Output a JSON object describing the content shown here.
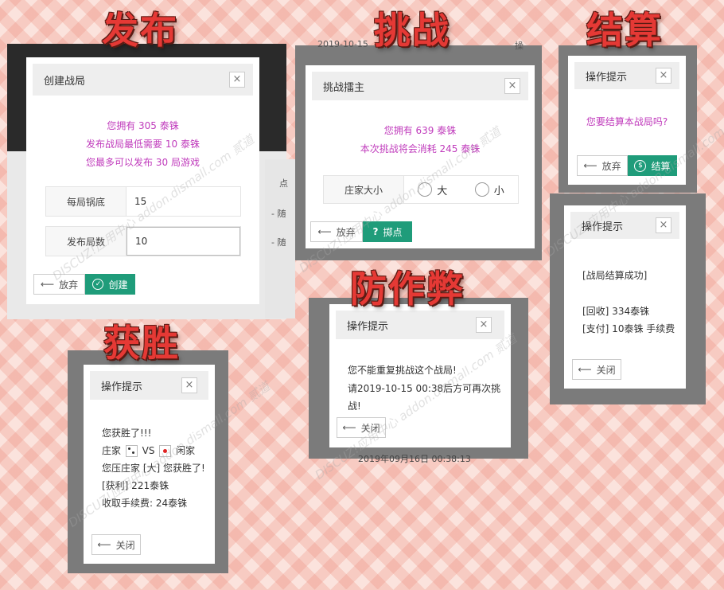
{
  "labels": {
    "publish": "发布",
    "challenge": "挑战",
    "settle": "结算",
    "win": "获胜",
    "anticheat": "防作弊"
  },
  "publish_dialog": {
    "title": "创建战局",
    "close": "×",
    "msg_line1": "您拥有 305 泰铢",
    "msg_line2": "发布战局最低需要 10 泰铢",
    "msg_line3": "您最多可以发布 30 局游戏",
    "row1_label": "每局锅底",
    "row1_value": "15",
    "row2_label": "发布局数",
    "row2_value": "10",
    "cancel": "放弃",
    "submit": "创建"
  },
  "challenge_dialog": {
    "title": "挑战擂主",
    "close": "×",
    "msg_line1": "您拥有 639 泰铢",
    "msg_line2": "本次挑战将会消耗 245 泰铢",
    "choice_label": "庄家大小",
    "option_big": "大",
    "option_small": "小",
    "cancel": "放弃",
    "submit": "掷点",
    "submit_icon": "?"
  },
  "settle_dialog": {
    "title": "操作提示",
    "close": "×",
    "msg": "您要结算本战局吗?",
    "cancel": "放弃",
    "submit": "结算"
  },
  "settle_result_dialog": {
    "title": "操作提示",
    "close": "×",
    "line1": "[战局结算成功]",
    "line2": "[回收] 334泰铢",
    "line3": "[支付] 10泰铢 手续费",
    "close_btn": "关闭"
  },
  "anticheat_dialog": {
    "title": "操作提示",
    "close": "×",
    "line1": "您不能重复挑战这个战局!",
    "line2": "请2019-10-15 00:38后方可再次挑战!",
    "close_btn": "关闭"
  },
  "win_dialog": {
    "title": "操作提示",
    "close": "×",
    "line1": "您获胜了!!!",
    "banker": "庄家",
    "vs": "VS",
    "player": "闲家",
    "line3": "您压庄家 [大] 您获胜了!",
    "line4": "[获利] 221泰铢",
    "line5": "收取手续费: 24泰铢",
    "close_btn": "关闭"
  },
  "background": {
    "top_date": "2019-10-15",
    "right_top": "操",
    "col_dian": "点",
    "row_sui1": "- 随",
    "row_sui2": "- 随",
    "bottom_date": "2019年09月16日 00:38:13"
  },
  "watermark": "DISCUZ!应用中心 addon.dismall.com 贰道",
  "colors": {
    "accent_green": "#1f9c7a",
    "message_purple": "#c03cbc",
    "label_red": "#e53935"
  }
}
